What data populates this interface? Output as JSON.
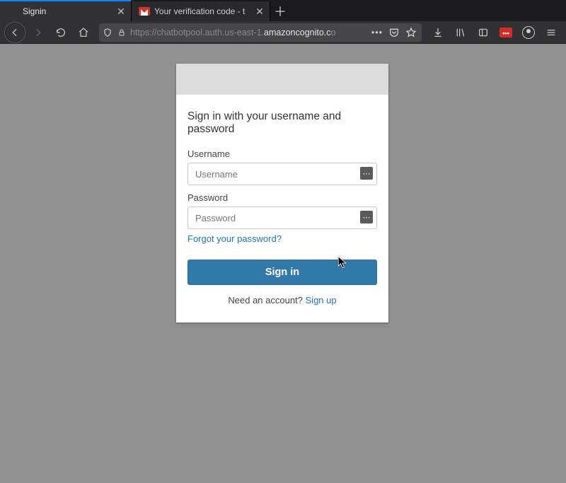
{
  "tabs": [
    {
      "title": "Signin",
      "active": true
    },
    {
      "title": "Your verification code - t",
      "active": false
    }
  ],
  "url": {
    "prefix": "https://chatbotpool.auth.us-east-1.",
    "domain": "amazoncognito.c",
    "suffix": "o"
  },
  "page": {
    "heading": "Sign in with your username and password",
    "username_label": "Username",
    "username_placeholder": "Username",
    "password_label": "Password",
    "password_placeholder": "Password",
    "forgot": "Forgot your password?",
    "signin": "Sign in",
    "signup_prompt": "Need an account? ",
    "signup": "Sign up"
  }
}
